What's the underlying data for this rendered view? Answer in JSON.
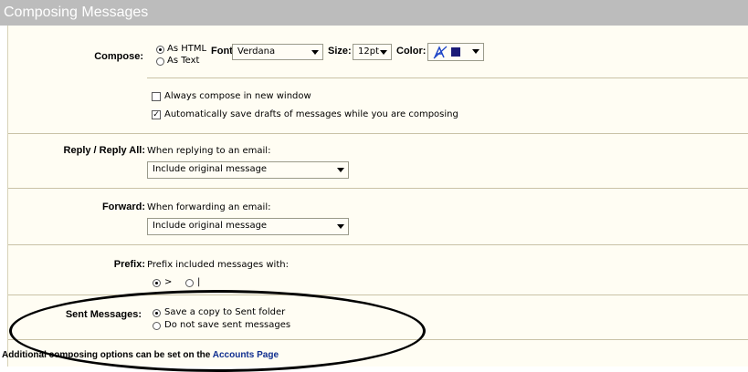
{
  "header": {
    "title": "Composing Messages"
  },
  "compose": {
    "label": "Compose:",
    "options": [
      {
        "label": "As HTML",
        "selected": true
      },
      {
        "label": "As Text",
        "selected": false
      }
    ],
    "font_label": "Font:",
    "font_value": "Verdana",
    "size_label": "Size:",
    "size_value": "12pt",
    "color_label": "Color:",
    "color_swatch": "#1b1b78",
    "checkboxes": [
      {
        "label": "Always compose in new window",
        "checked": false
      },
      {
        "label": "Automatically save drafts of messages while you are composing",
        "checked": true
      }
    ]
  },
  "reply": {
    "label": "Reply / Reply All:",
    "hint": "When replying to an email:",
    "value": "Include original message"
  },
  "forward": {
    "label": "Forward:",
    "hint": "When forwarding an email:",
    "value": "Include original message"
  },
  "prefix": {
    "label": "Prefix:",
    "hint": "Prefix included messages with:",
    "options": [
      {
        "label": ">",
        "selected": true
      },
      {
        "label": "|",
        "selected": false
      }
    ]
  },
  "sent": {
    "label": "Sent Messages:",
    "options": [
      {
        "label": "Save a copy to Sent folder",
        "selected": true
      },
      {
        "label": "Do not save sent messages",
        "selected": false
      }
    ]
  },
  "footer": {
    "text": "Additional composing options can be set on the",
    "link": "Accounts Page"
  },
  "colors": {
    "header_bg": "#bcbcbc",
    "panel_bg": "#fffdf3",
    "link": "#0f2e8f",
    "annotation": "#000000"
  }
}
